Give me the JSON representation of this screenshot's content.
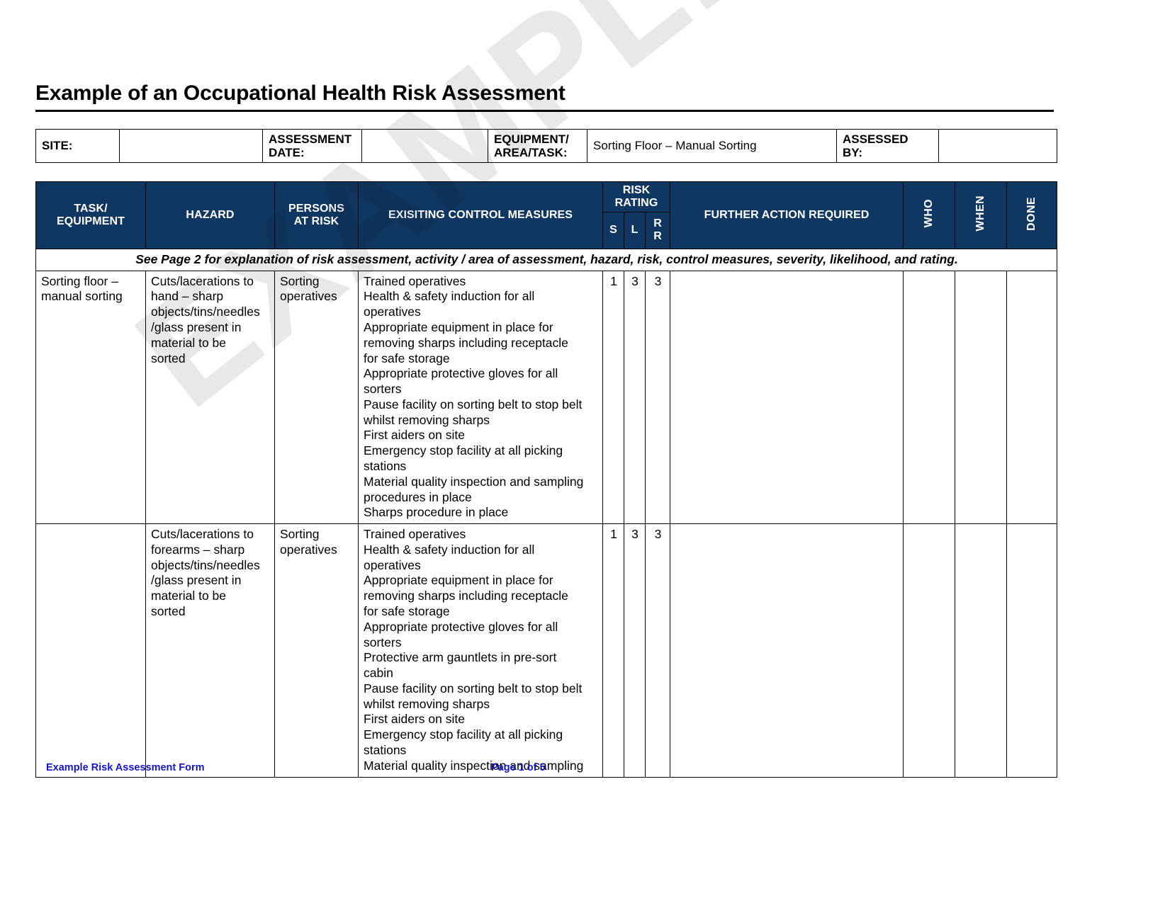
{
  "document": {
    "title": "Example of an Occupational Health Risk Assessment",
    "watermark": "EXAMPLE ONLY"
  },
  "info": {
    "site_label": "SITE:",
    "site_value": "",
    "assessment_date_label": "ASSESSMENT\nDATE:",
    "assessment_date_label_line1": "ASSESSMENT",
    "assessment_date_label_line2": "DATE:",
    "assessment_date_value": "",
    "equipment_label_line1": "EQUIPMENT/",
    "equipment_label_line2": "AREA/TASK:",
    "equipment_value": "Sorting Floor – Manual Sorting",
    "assessed_by_label_line1": "ASSESSED",
    "assessed_by_label_line2": "BY:",
    "assessed_by_value": ""
  },
  "table": {
    "headers": {
      "task_equipment_line1": "TASK/",
      "task_equipment_line2": "EQUIPMENT",
      "hazard": "HAZARD",
      "persons_at_risk_line1": "PERSONS",
      "persons_at_risk_line2": "AT RISK",
      "existing_control_measures": "EXISITING CONTROL MEASURES",
      "risk_rating_line1": "RISK",
      "risk_rating_line2": "RATING",
      "severity": "S",
      "likelihood": "L",
      "rating": "R\nR",
      "further_action_required": "FURTHER ACTION REQUIRED",
      "who": "WHO",
      "when": "WHEN",
      "done": "DONE"
    },
    "note": "See Page 2 for explanation of risk assessment, activity / area of assessment, hazard, risk, control measures, severity, likelihood, and rating.",
    "rows": [
      {
        "task_equipment": "Sorting floor –\nmanual sorting",
        "hazard": "Cuts/lacerations to\nhand – sharp\nobjects/tins/needles\n/glass present in\nmaterial to be\nsorted",
        "persons_at_risk": "Sorting\noperatives",
        "existing_control_measures": "Trained operatives\nHealth & safety induction for all\noperatives\nAppropriate equipment in place for\nremoving sharps including receptacle\nfor safe storage\nAppropriate protective gloves for all\nsorters\nPause facility on sorting belt to stop belt\nwhilst removing sharps\nFirst aiders on site\nEmergency stop facility at all picking\nstations\nMaterial quality inspection and sampling\nprocedures in place\nSharps procedure in place",
        "severity": "1",
        "likelihood": "3",
        "rating": "3",
        "further_action_required": "",
        "who": "",
        "when": "",
        "done": ""
      },
      {
        "task_equipment": "",
        "hazard": "Cuts/lacerations to\nforearms – sharp\nobjects/tins/needles\n/glass present in\nmaterial to be\nsorted",
        "persons_at_risk": "Sorting\noperatives",
        "existing_control_measures": "Trained operatives\nHealth & safety induction for all\noperatives\nAppropriate equipment in place for\nremoving sharps including receptacle\nfor safe storage\nAppropriate protective gloves for all\nsorters\nProtective arm gauntlets in pre-sort\ncabin\nPause facility on sorting belt to stop belt\nwhilst removing sharps\nFirst aiders on site\nEmergency stop facility at all picking\nstations\nMaterial quality inspection and sampling",
        "severity": "1",
        "likelihood": "3",
        "rating": "3",
        "further_action_required": "",
        "who": "",
        "when": "",
        "done": ""
      }
    ]
  },
  "footer": {
    "left": "Example Risk Assessment Form",
    "right": "Page  1 of 5"
  },
  "colors": {
    "header_blue": "#103761",
    "footer_blue": "#1414c8",
    "text": "#000000"
  }
}
